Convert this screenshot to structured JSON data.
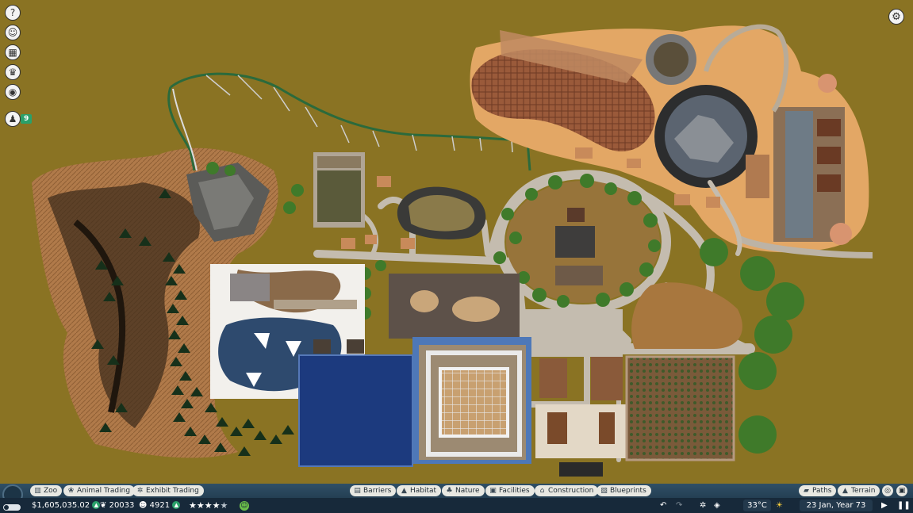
{
  "left_toolbar": [
    {
      "name": "help-icon",
      "glyph": "?"
    },
    {
      "name": "guest-icon",
      "glyph": "☺"
    },
    {
      "name": "calendar-icon",
      "glyph": "▦"
    },
    {
      "name": "trophy-icon",
      "glyph": "♛"
    },
    {
      "name": "view-icon",
      "glyph": "◉"
    }
  ],
  "staff": {
    "icon": "staff-icon",
    "glyph": "♟",
    "count": "9"
  },
  "settings": {
    "icon": "gear-icon",
    "glyph": "⚙"
  },
  "top_tabs": {
    "left": [
      {
        "name": "tab-zoo",
        "icon": "zoo-icon",
        "glyph": "▥",
        "label": "Zoo"
      },
      {
        "name": "tab-animal-trading",
        "icon": "paw-icon",
        "glyph": "❀",
        "label": "Animal Trading"
      },
      {
        "name": "tab-exhibit-trading",
        "icon": "lizard-icon",
        "glyph": "✲",
        "label": "Exhibit Trading"
      }
    ],
    "center": [
      {
        "name": "tab-barriers",
        "icon": "barrier-icon",
        "glyph": "▤",
        "label": "Barriers"
      },
      {
        "name": "tab-habitat",
        "icon": "habitat-icon",
        "glyph": "▲",
        "label": "Habitat"
      },
      {
        "name": "tab-nature",
        "icon": "tree-icon",
        "glyph": "♣",
        "label": "Nature"
      },
      {
        "name": "tab-facilities",
        "icon": "facilities-icon",
        "glyph": "▣",
        "label": "Facilities"
      },
      {
        "name": "tab-construction",
        "icon": "construction-icon",
        "glyph": "⌂",
        "label": "Construction"
      },
      {
        "name": "tab-blueprints",
        "icon": "blueprint-icon",
        "glyph": "▧",
        "label": "Blueprints"
      }
    ],
    "right": [
      {
        "name": "tab-paths",
        "icon": "paths-icon",
        "glyph": "▰",
        "label": "Paths"
      },
      {
        "name": "tab-terrain",
        "icon": "terrain-icon",
        "glyph": "▲",
        "label": "Terrain"
      }
    ]
  },
  "status": {
    "money": "$1,605,035.02",
    "conservation_credits": "20033",
    "guests": "4921",
    "rating_stars": 4.5,
    "weather": {
      "temperature": "33°C"
    },
    "date": "23 Jan, Year 73"
  },
  "colors": {
    "accent_green": "#2aa06a",
    "bar_dark": "#17293a",
    "bar_mid": "#2f4f66",
    "tab_bg": "#e8e8e2"
  }
}
